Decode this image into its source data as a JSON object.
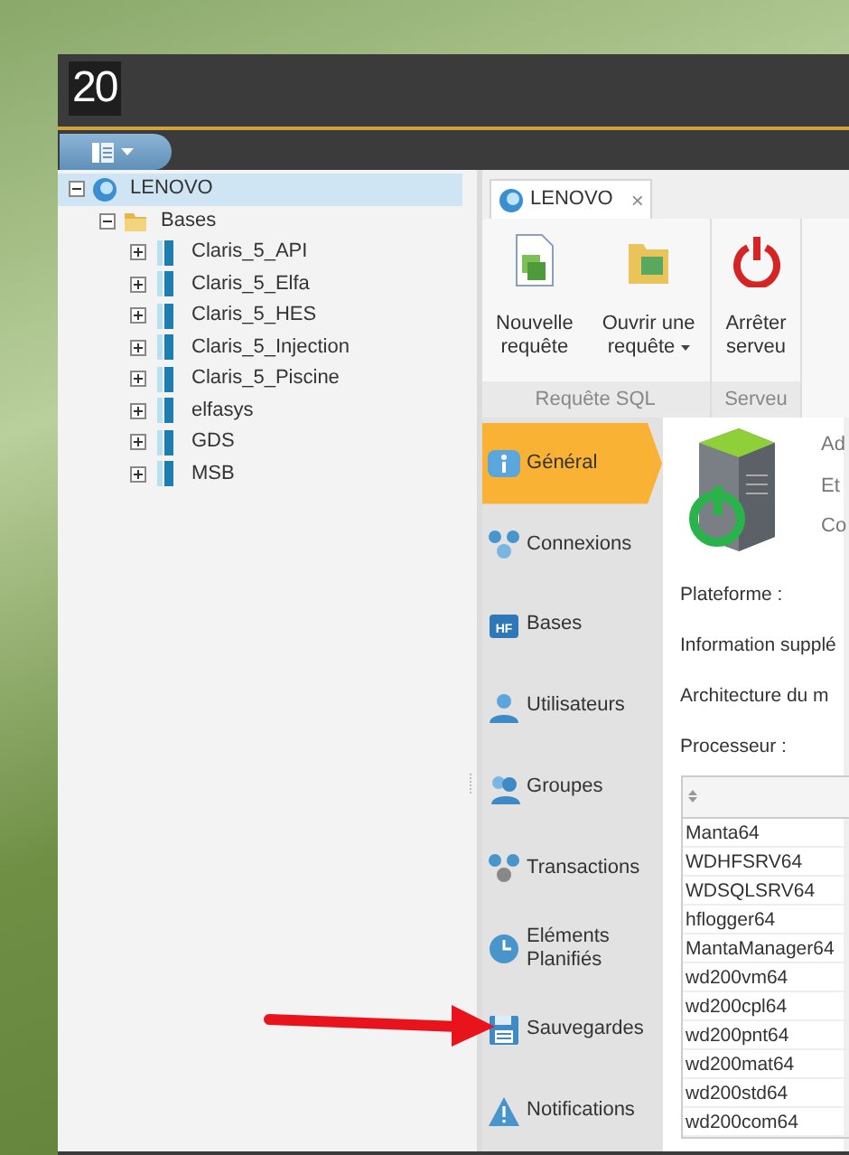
{
  "app": {
    "logo": "20"
  },
  "tree": [
    {
      "label": "LENOVO",
      "kind": "server",
      "expanded": true,
      "selected": true,
      "children": [
        {
          "label": "Bases",
          "kind": "folder",
          "expanded": true,
          "selected": false,
          "children": [
            {
              "label": "Claris_5_API",
              "kind": "database",
              "expanded": false,
              "selected": false
            },
            {
              "label": "Claris_5_Elfa",
              "kind": "database",
              "expanded": false,
              "selected": false
            },
            {
              "label": "Claris_5_HES",
              "kind": "database",
              "expanded": false,
              "selected": false
            },
            {
              "label": "Claris_5_Injection",
              "kind": "database",
              "expanded": false,
              "selected": false
            },
            {
              "label": "Claris_5_Piscine",
              "kind": "database",
              "expanded": false,
              "selected": false
            },
            {
              "label": "elfasys",
              "kind": "database",
              "expanded": false,
              "selected": false
            },
            {
              "label": "GDS",
              "kind": "database",
              "expanded": false,
              "selected": false
            },
            {
              "label": "MSB",
              "kind": "database",
              "expanded": false,
              "selected": false
            }
          ]
        }
      ]
    }
  ],
  "document_tabs": [
    {
      "label": "LENOVO",
      "close": "×",
      "selected": true
    }
  ],
  "ribbon": {
    "groups": [
      {
        "label": "Requête SQL",
        "buttons": [
          {
            "lines": [
              "Nouvelle",
              "requête"
            ],
            "kind": "new",
            "dropdown": false
          },
          {
            "lines": [
              "Ouvrir une",
              "requête"
            ],
            "kind": "open",
            "dropdown": true
          }
        ]
      },
      {
        "label": "Serveu",
        "buttons": [
          {
            "lines": [
              "Arrêter",
              "serveu"
            ],
            "kind": "power",
            "dropdown": false
          }
        ]
      }
    ]
  },
  "nav": [
    {
      "label": "Général",
      "kind": "info",
      "selected": true
    },
    {
      "label": "Connexions",
      "kind": "connections",
      "selected": false
    },
    {
      "label": "Bases",
      "kind": "hf",
      "icon_text": "HF",
      "selected": false
    },
    {
      "label": "Utilisateurs",
      "kind": "user",
      "selected": false
    },
    {
      "label": "Groupes",
      "kind": "group",
      "selected": false
    },
    {
      "label": "Transactions",
      "kind": "transactions",
      "selected": false
    },
    {
      "label": "Eléments Planifiés",
      "kind": "clock",
      "selected": false
    },
    {
      "label": "Sauvegardes",
      "kind": "save",
      "selected": false
    },
    {
      "label": "Notifications",
      "kind": "warning",
      "selected": false
    }
  ],
  "general": {
    "status_labels": [
      "Ad",
      "Et",
      "Co"
    ],
    "fields": [
      "Plateforme :",
      "Information supplé",
      "Architecture du m",
      "Processeur :"
    ],
    "process_table": {
      "rows": [
        "Manta64",
        "WDHFSRV64",
        "WDSQLSRV64",
        "hflogger64",
        "MantaManager64",
        "wd200vm64",
        "wd200cpl64",
        "wd200pnt64",
        "wd200mat64",
        "wd200std64",
        "wd200com64"
      ]
    }
  }
}
